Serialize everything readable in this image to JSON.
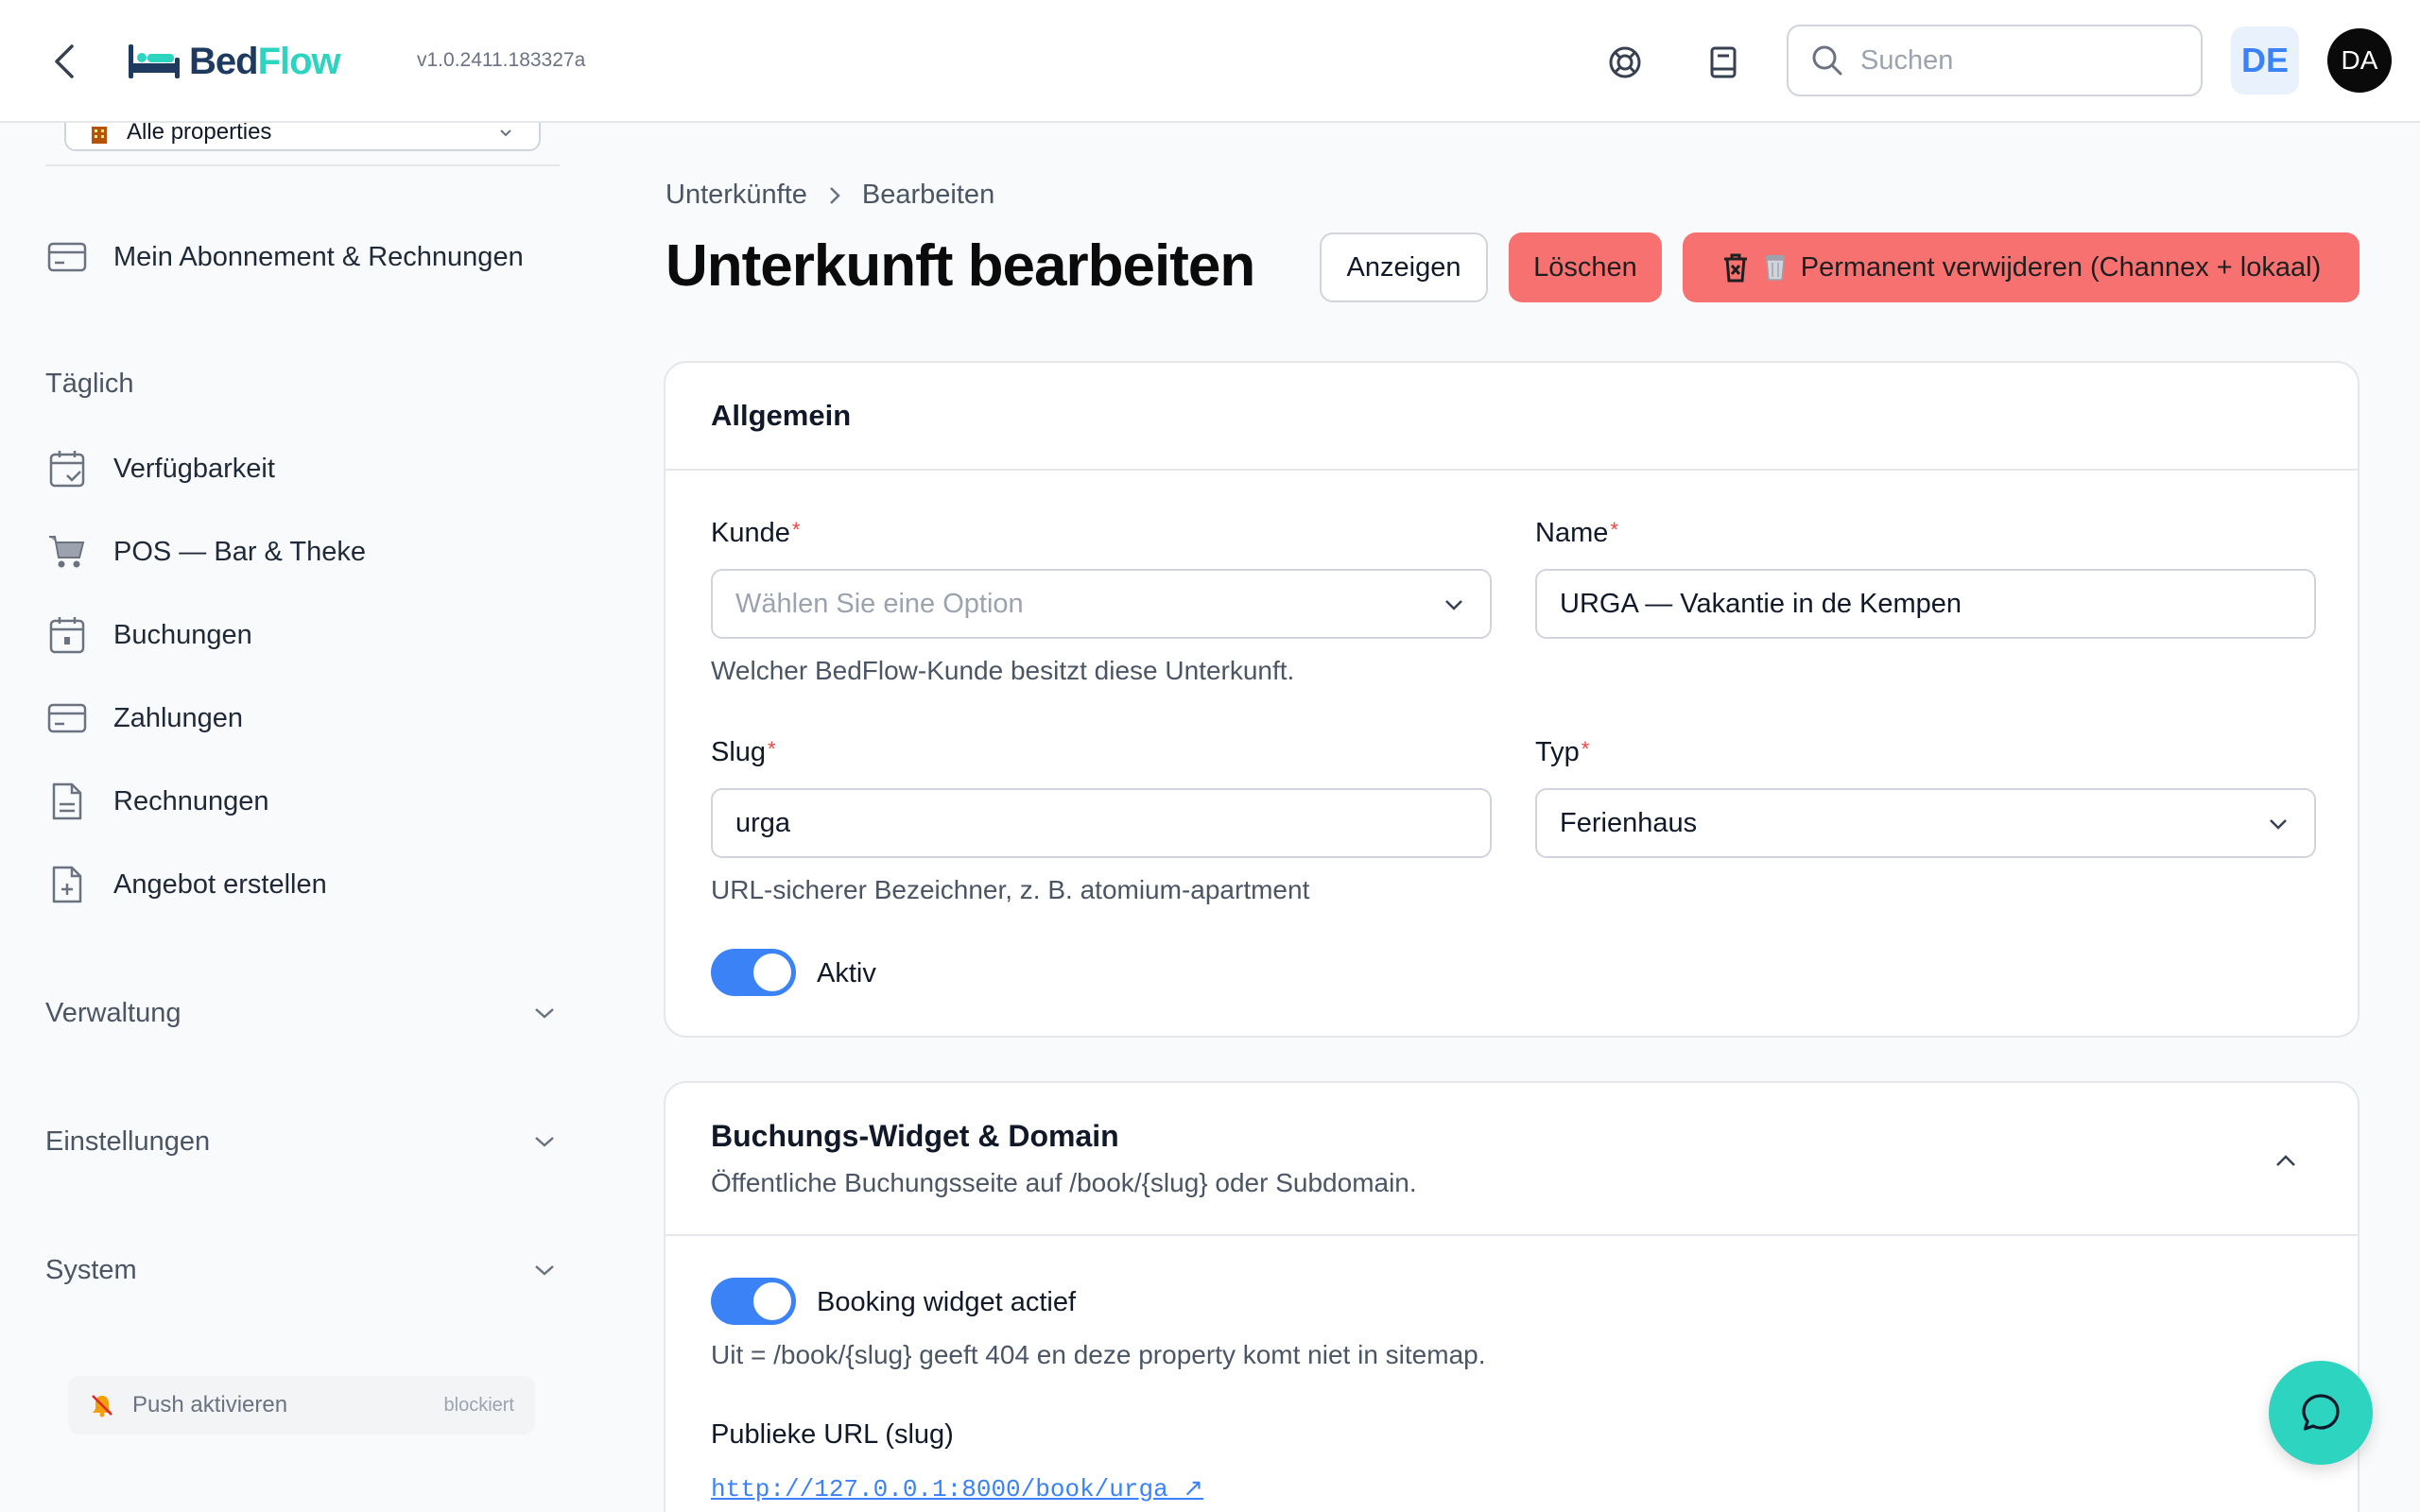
{
  "topbar": {
    "brand_part1": "Bed",
    "brand_part2": "Flow",
    "version": "v1.0.2411.183327a",
    "search_placeholder": "Suchen",
    "language": "DE",
    "user_initials": "DA",
    "icons": [
      "back-icon",
      "support-lifebuoy-icon",
      "docs-book-icon",
      "search-icon"
    ]
  },
  "sidebar": {
    "property_select": "Alle properties",
    "subscription": "Mein Abonnement & Rechnungen",
    "daily_label": "Täglich",
    "daily_items": [
      {
        "label": "Verfügbarkeit",
        "icon": "calendar-check-icon"
      },
      {
        "label": "POS — Bar & Theke",
        "icon": "cart-icon"
      },
      {
        "label": "Buchungen",
        "icon": "calendar-icon"
      },
      {
        "label": "Zahlungen",
        "icon": "credit-card-icon"
      },
      {
        "label": "Rechnungen",
        "icon": "document-icon"
      },
      {
        "label": "Angebot erstellen",
        "icon": "document-plus-icon"
      }
    ],
    "groups": [
      {
        "label": "Verwaltung"
      },
      {
        "label": "Einstellungen"
      },
      {
        "label": "System"
      }
    ],
    "push": {
      "label": "Push aktivieren",
      "state": "blockiert"
    }
  },
  "main": {
    "breadcrumb": [
      "Unterkünfte",
      "Bearbeiten"
    ],
    "title": "Unterkunft bearbeiten",
    "actions": {
      "show": "Anzeigen",
      "delete": "Löschen",
      "permanent_delete": "Permanent verwijderen (Channex + lokaal)"
    },
    "general": {
      "heading": "Allgemein",
      "kunde_label": "Kunde",
      "kunde_placeholder": "Wählen Sie eine Option",
      "kunde_help": "Welcher BedFlow-Kunde besitzt diese Unterkunft.",
      "name_label": "Name",
      "name_value": "URGA — Vakantie in de Kempen",
      "slug_label": "Slug",
      "slug_value": "urga",
      "slug_help": "URL-sicherer Bezeichner, z. B. atomium-apartment",
      "typ_label": "Typ",
      "typ_value": "Ferienhaus",
      "active_label": "Aktiv",
      "active_on": true
    },
    "widget": {
      "heading": "Buchungs-Widget & Domain",
      "subtitle": "Öffentliche Buchungsseite auf /book/{slug} oder Subdomain.",
      "toggle_label": "Booking widget actief",
      "toggle_on": true,
      "toggle_help": "Uit = /book/{slug} geeft 404 en deze property komt niet in sitemap.",
      "url_label": "Publieke URL (slug)",
      "url_value": "http://127.0.0.1:8000/book/urga ↗"
    }
  },
  "colors": {
    "accent": "#3b82f6",
    "brand_teal": "#2dd4bf",
    "danger": "#f87171"
  }
}
